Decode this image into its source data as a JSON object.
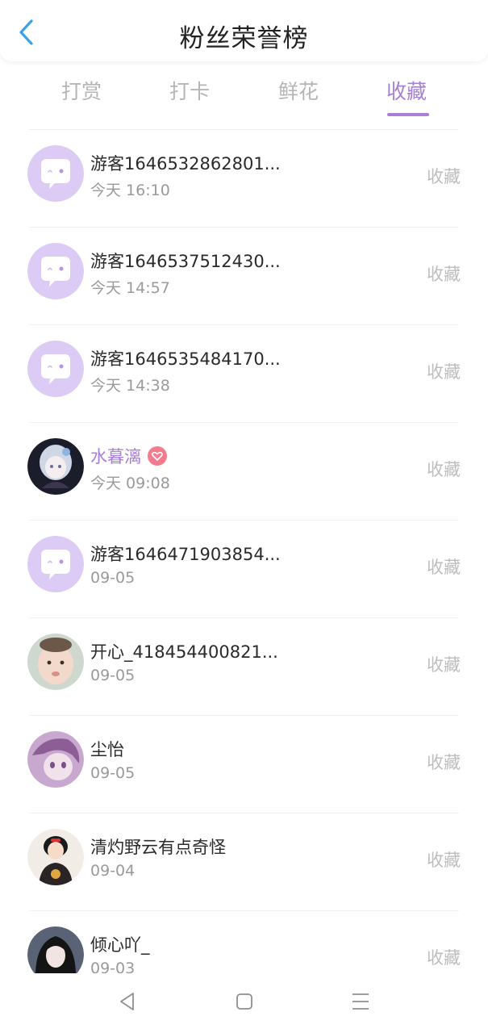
{
  "header": {
    "title": "粉丝荣誉榜",
    "back_icon": "chevron-left-icon"
  },
  "tabs": [
    {
      "label": "打赏",
      "active": false
    },
    {
      "label": "打卡",
      "active": false
    },
    {
      "label": "鲜花",
      "active": false
    },
    {
      "label": "收藏",
      "active": true
    }
  ],
  "colors": {
    "accent": "#a77fd8",
    "avatar_bg": "#dccbf4",
    "inactive_text": "#b5b5b5"
  },
  "list": [
    {
      "name": "游客1646532862801...",
      "time": "今天 16:10",
      "action": "收藏",
      "avatar": "chat-bubble-avatar"
    },
    {
      "name": "游客1646537512430...",
      "time": "今天 14:57",
      "action": "收藏",
      "avatar": "chat-bubble-avatar"
    },
    {
      "name": "游客1646535484170...",
      "time": "今天 14:38",
      "action": "收藏",
      "avatar": "chat-bubble-avatar"
    },
    {
      "name": "水暮漓",
      "time": "今天 09:08",
      "action": "收藏",
      "avatar": "anime-girl-avatar",
      "badge": "heart-badge-icon"
    },
    {
      "name": "游客1646471903854...",
      "time": "09-05",
      "action": "收藏",
      "avatar": "chat-bubble-avatar"
    },
    {
      "name": "开心_418454400821...",
      "time": "09-05",
      "action": "收藏",
      "avatar": "baby-photo-avatar"
    },
    {
      "name": "尘怡",
      "time": "09-05",
      "action": "收藏",
      "avatar": "anime-face-avatar"
    },
    {
      "name": "清灼野云有点奇怪",
      "time": "09-04",
      "action": "收藏",
      "avatar": "princess-avatar"
    },
    {
      "name": "倾心吖_",
      "time": "09-03",
      "action": "收藏",
      "avatar": "dark-hair-avatar"
    }
  ],
  "navbar": {
    "back": "triangle-back-icon",
    "home": "square-home-icon",
    "menu": "three-lines-menu-icon"
  }
}
